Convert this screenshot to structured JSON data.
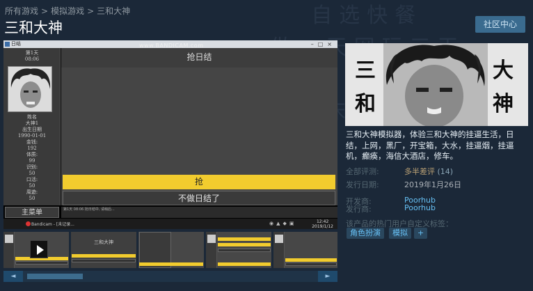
{
  "breadcrumb": [
    "所有游戏",
    "模拟游戏",
    "三和大神"
  ],
  "page_title": "三和大神",
  "community_button": "社区中心",
  "media": {
    "window_title": "日结",
    "watermark": "www.BANDICAM.com",
    "left_panel": {
      "day": "第1天",
      "time": "08:06",
      "stats": [
        "姓名",
        "大神1",
        "出生日期",
        "1990-01-01",
        "金钱:",
        "192",
        "体质:",
        "99",
        "识别:",
        "50",
        "口活:",
        "50",
        "周遊:",
        "50"
      ]
    },
    "main_menu_tab": "主菜单",
    "game_heading": "抢日结",
    "action_primary": "抢",
    "action_secondary": "不做日结了",
    "status_text": "第1天 08:06 抢日结中, 请稍后...",
    "taskbar_app": "Bandicam - [未记录...",
    "taskbar_time": "12:42",
    "taskbar_date": "2019/1/12",
    "thumbnails": [
      {
        "type": "video",
        "selected": true
      },
      {
        "type": "screenshot",
        "caption": "三和大神"
      },
      {
        "type": "screenshot"
      },
      {
        "type": "screenshot"
      },
      {
        "type": "screenshot"
      }
    ]
  },
  "scroll": {
    "left_arrow": "◄",
    "right_arrow": "►"
  },
  "capsule": {
    "chars": [
      "三",
      "和",
      "大",
      "神"
    ]
  },
  "description": "三和大神模拟器，体验三和大神的挂逼生活，日结，上网，黑厂，开宝箱，大水，挂逼烟，挂逼机，癫痪，海信大酒店，修车。",
  "reviews": {
    "label": "全部评测:",
    "value": "多半差评",
    "count": "(14)"
  },
  "release": {
    "label": "发行日期:",
    "value": "2019年1月26日"
  },
  "developer": {
    "label": "开发商:",
    "value": "Poorhub"
  },
  "publisher": {
    "label": "发行商:",
    "value": "Poorhub"
  },
  "tags": {
    "label": "该产品的热门用户自定义标签：",
    "items": [
      "角色扮演",
      "模拟",
      "+"
    ]
  },
  "colors": {
    "accent": "#66c0f4",
    "background": "#1b2838",
    "mixed_review": "#b9a074",
    "game_yellow": "#f2cc2e"
  }
}
